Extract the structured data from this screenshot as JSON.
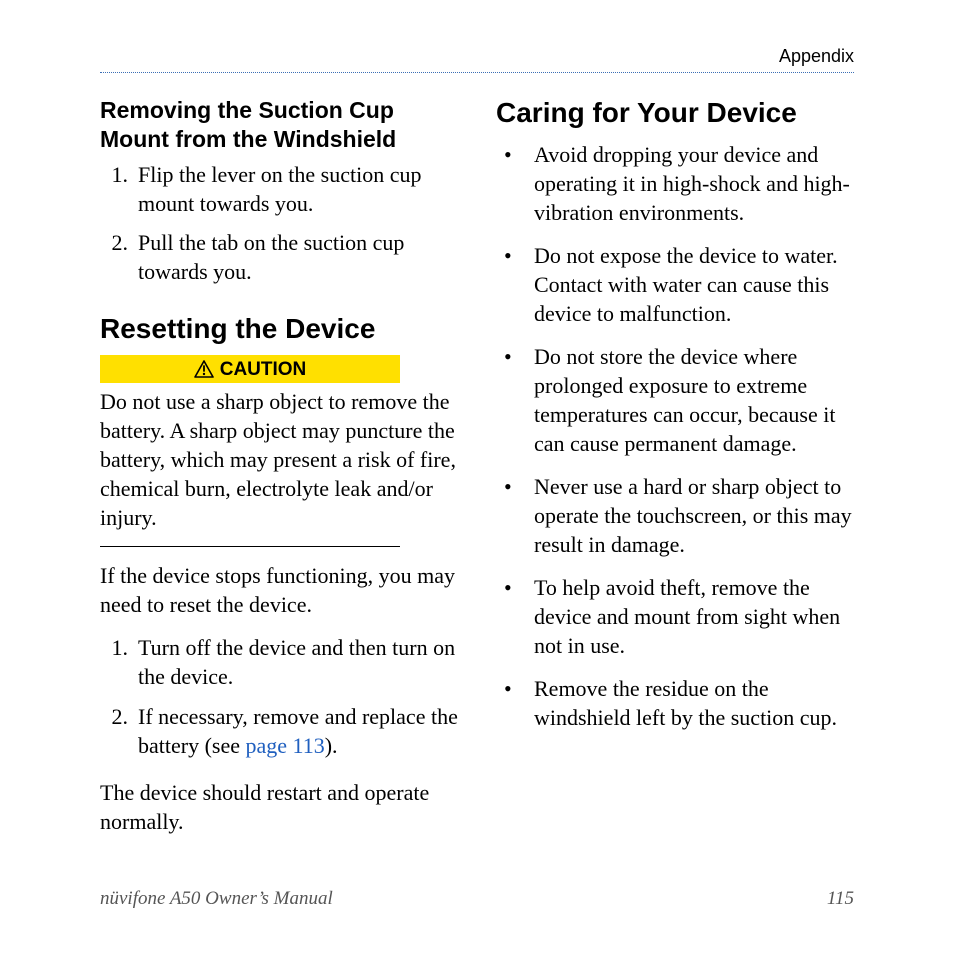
{
  "header": {
    "section": "Appendix"
  },
  "left": {
    "h3": "Removing the Suction Cup Mount from the Windshield",
    "steps1": [
      "Flip the lever on the suction cup mount towards you.",
      "Pull the tab on the suction cup towards you."
    ],
    "h2": "Resetting the Device",
    "caution_label": "CAUTION",
    "caution_text": "Do not use a sharp object to remove the battery. A sharp object may puncture the battery, which may present a risk of fire, chemical burn, electrolyte leak and/or injury.",
    "para1": "If the device stops functioning, you may need to reset the device.",
    "steps2": [
      "Turn off the device and then turn on the device.",
      "If necessary, remove and replace the battery (see "
    ],
    "link_text": "page 113",
    "link_after": ").",
    "para2": "The device should restart and operate normally."
  },
  "right": {
    "h2": "Caring for Your Device",
    "bullets": [
      "Avoid dropping your device and operating it in high-shock and high-vibration environments.",
      "Do not expose the device to water. Contact with water can cause this device to malfunction.",
      "Do not store the device where prolonged exposure to extreme temperatures can occur, because it can cause permanent damage.",
      "Never use a hard or sharp object to operate the touchscreen, or this may result in damage.",
      "To help avoid theft, remove the device and mount from sight when not in use.",
      "Remove the residue on the windshield left by the suction cup."
    ]
  },
  "footer": {
    "title": "nüvifone A50 Owner’s Manual",
    "page": "115"
  }
}
